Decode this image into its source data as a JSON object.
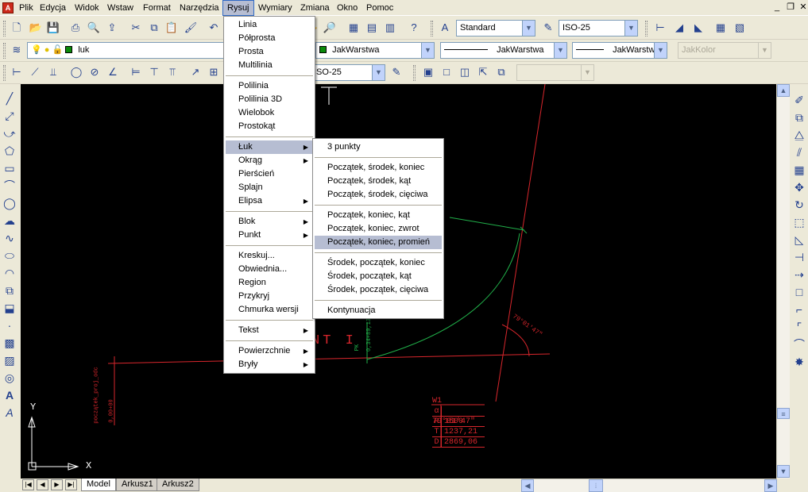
{
  "menubar": {
    "items": [
      "Plik",
      "Edycja",
      "Widok",
      "Wstaw",
      "Format",
      "Narzędzia",
      "Rysuj",
      "Wymiary",
      "Zmiana",
      "Okno",
      "Pomoc"
    ],
    "active": "Rysuj"
  },
  "toolbar": {
    "text_style": "Standard",
    "dim_style": "ISO-25",
    "layer": "luk",
    "color": "JakWarstwa",
    "linetype": "JakWarstwa",
    "lineweight": "JakWarstwa",
    "plotstyle": "JakKolor",
    "dim_style2": "ISO-25",
    "layer_color": "#0a8a0a"
  },
  "rysuj_menu": {
    "groups": [
      [
        "Linia",
        "Półprosta",
        "Prosta",
        "Multilinia"
      ],
      [
        "Polilinia",
        "Polilinia 3D",
        "Wielobok",
        "Prostokąt"
      ],
      [
        "Łuk",
        "Okrąg",
        "Pierścień",
        "Splajn",
        "Elipsa"
      ],
      [
        "Blok",
        "Punkt"
      ],
      [
        "Kreskuj...",
        "Obwiednia...",
        "Region",
        "Przykryj",
        "Chmurka wersji"
      ],
      [
        "Tekst"
      ],
      [
        "Powierzchnie",
        "Bryły"
      ]
    ],
    "highlighted": "Łuk"
  },
  "luk_submenu": {
    "groups": [
      [
        "3 punkty"
      ],
      [
        "Początek, środek, koniec",
        "Początek, środek, kąt",
        "Początek, środek, cięciwa"
      ],
      [
        "Początek, koniec, kąt",
        "Początek, koniec, zwrot",
        "Początek, koniec, promień"
      ],
      [
        "Środek, początek, koniec",
        "Środek, początek, kąt",
        "Środek, początek, cięciwa"
      ],
      [
        "Kontynuacja"
      ]
    ],
    "highlighted": "Początek, koniec, promień"
  },
  "drawing": {
    "label_nt": "NT I",
    "angle_label": "79°01'47\"",
    "start_label": "początek_proj_odc",
    "start_sub": "0,00+00",
    "pk_label": "PK",
    "pk_value": "0,34+89,13",
    "table": [
      {
        "k": "W1",
        "v": ""
      },
      {
        "k": "α",
        "v": "79°01'47\""
      },
      {
        "k": "R",
        "v": "1500"
      },
      {
        "k": "T",
        "v": "1237,21"
      },
      {
        "k": "D",
        "v": "2869,06"
      }
    ],
    "ucs_x": "X",
    "ucs_y": "Y"
  },
  "tabs": [
    "Model",
    "Arkusz1",
    "Arkusz2"
  ],
  "active_tab": "Model"
}
